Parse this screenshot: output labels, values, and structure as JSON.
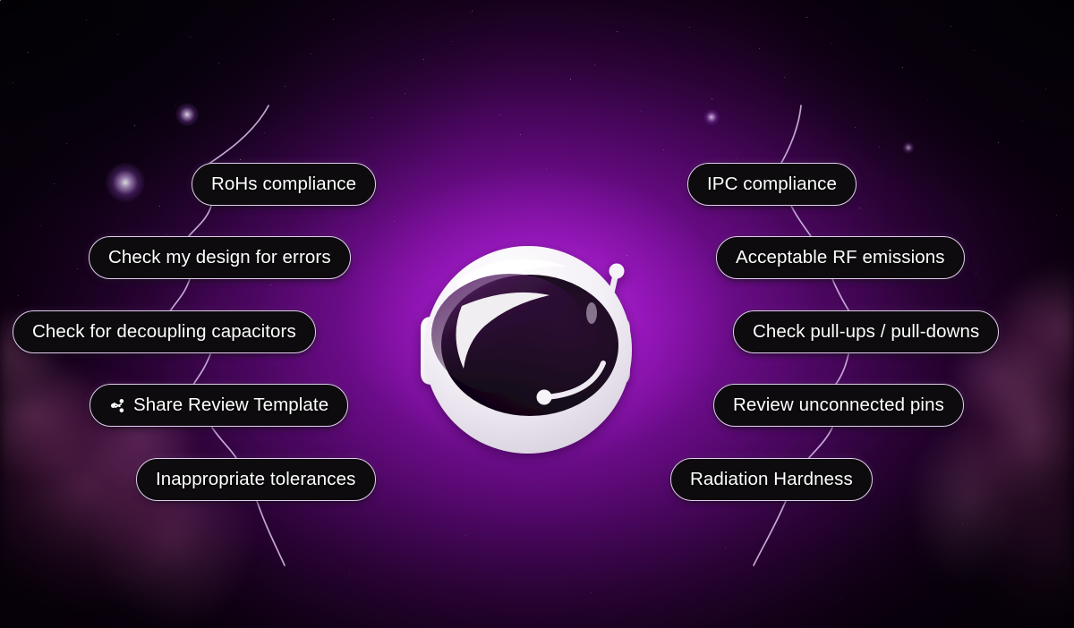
{
  "scene": {
    "title": "Space themed PCB design review prompt menu",
    "background_theme": "purple nebula starfield",
    "colors": {
      "nebula_core": "#a017c8",
      "nebula_deep": "#4d0763",
      "space_dark": "#0d0010",
      "pill_fill": "#0d0b0d",
      "pill_border": "#e3cdf0",
      "pill_text": "#ffffff",
      "connector_line": "#d9c0e8",
      "helmet_white": "#f4f1f6",
      "visor_dark": "#150a18"
    }
  },
  "logo": {
    "name": "astronaut-helmet-logo",
    "alt": "Astronaut helmet with dark visor and antenna",
    "parts": [
      "helmet-shell",
      "visor",
      "antenna",
      "ear-cup-left",
      "ear-cup-right",
      "mic-boom",
      "visor-highlight"
    ]
  },
  "left_column": {
    "name": "left-prompt-column",
    "items": [
      {
        "id": "rohs-compliance",
        "label": "RoHs compliance",
        "icon": null
      },
      {
        "id": "check-design-errors",
        "label": "Check my design for errors",
        "icon": null
      },
      {
        "id": "check-decoupling-capacitors",
        "label": "Check for decoupling capacitors",
        "icon": null
      },
      {
        "id": "share-review-template",
        "label": "Share Review Template",
        "icon": "share-icon"
      },
      {
        "id": "inappropriate-tolerances",
        "label": "Inappropriate tolerances",
        "icon": null
      }
    ]
  },
  "right_column": {
    "name": "right-prompt-column",
    "items": [
      {
        "id": "ipc-compliance",
        "label": "IPC compliance",
        "icon": null
      },
      {
        "id": "acceptable-rf-emissions",
        "label": "Acceptable RF emissions",
        "icon": null
      },
      {
        "id": "check-pullups-pulldowns",
        "label": "Check pull-ups / pull-downs",
        "icon": null
      },
      {
        "id": "review-unconnected-pins",
        "label": "Review unconnected pins",
        "icon": null
      },
      {
        "id": "radiation-hardness",
        "label": "Radiation Hardness",
        "icon": null
      }
    ]
  }
}
